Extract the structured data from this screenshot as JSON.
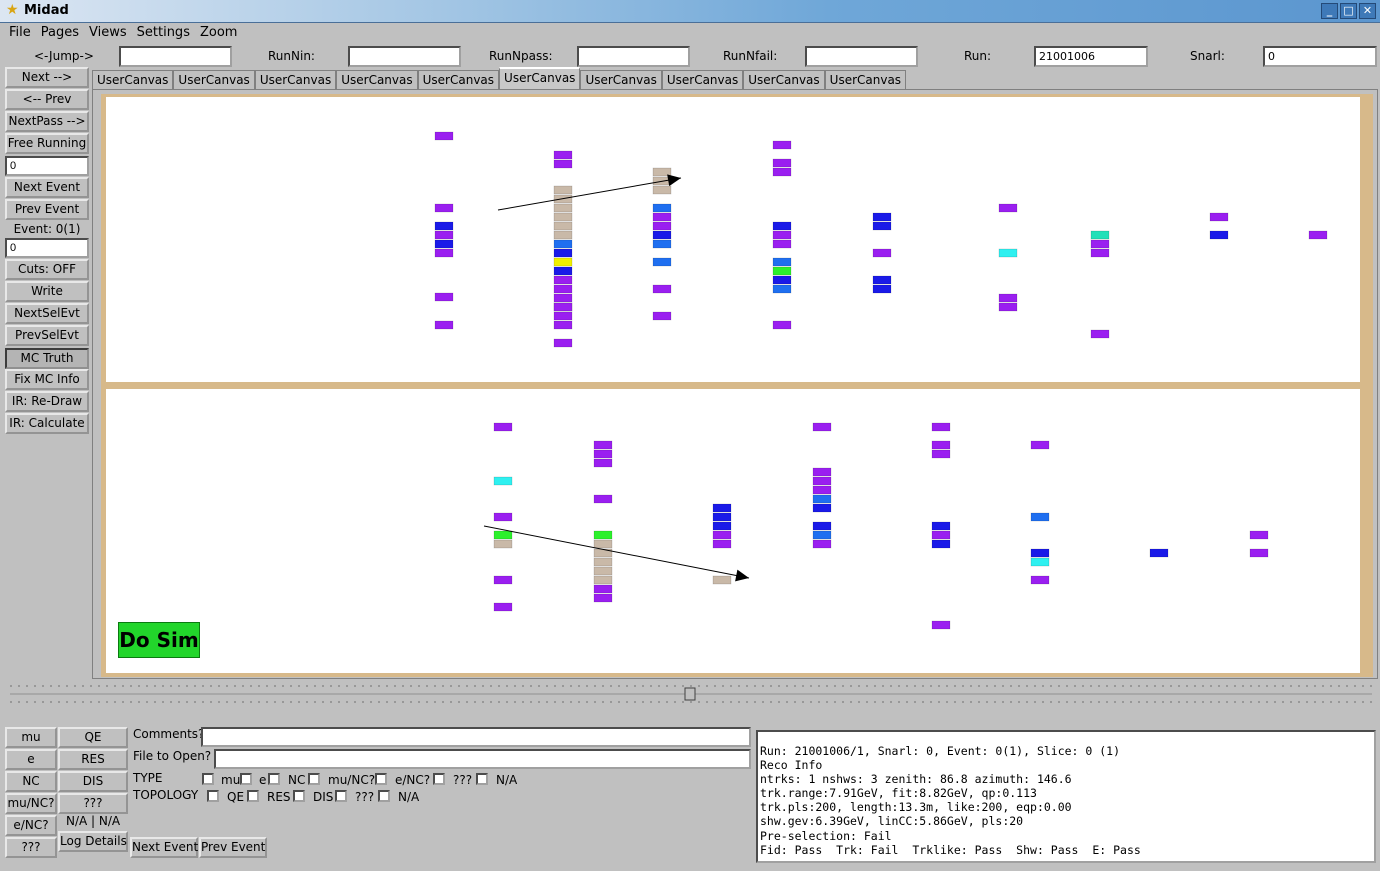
{
  "window": {
    "title": "Midad"
  },
  "menu": [
    "File",
    "Pages",
    "Views",
    "Settings",
    "Zoom"
  ],
  "fields": {
    "jump_label": "<-Jump->",
    "jump_value": "",
    "runnin_label": "RunNin:",
    "runnin_value": "",
    "runnpass_label": "RunNpass:",
    "runnpass_value": "",
    "runnfail_label": "RunNfail:",
    "runnfail_value": "",
    "run_label": "Run:",
    "run_value": "21001006",
    "snarl_label": "Snarl:",
    "snarl_value": "0"
  },
  "left": {
    "next": "Next -->",
    "prev": "<-- Prev",
    "nextpass": "NextPass -->",
    "free_running": "Free Running",
    "input1": "0",
    "next_event": "Next Event",
    "prev_event": "Prev Event",
    "event_label": "Event: 0(1)",
    "input2": "0",
    "cuts": "Cuts: OFF",
    "write": "Write",
    "nextselevt": "NextSelEvt",
    "prevselevt": "PrevSelEvt",
    "mc_truth": "MC Truth",
    "fix_mc": "Fix MC Info",
    "ir_redraw": "IR: Re-Draw",
    "ir_calc": "IR: Calculate"
  },
  "tabs": [
    "UserCanvas",
    "UserCanvas",
    "UserCanvas",
    "UserCanvas",
    "UserCanvas",
    "UserCanvas",
    "UserCanvas",
    "UserCanvas",
    "UserCanvas",
    "UserCanvas"
  ],
  "active_tab": 5,
  "do_sim": "Do Sim",
  "colors": {
    "purple": "#9a1ff0",
    "blue": "#1a1ae8",
    "midblue": "#1f6ff0",
    "cyan": "#2ff0f0",
    "green": "#2cf02c",
    "yellow": "#f0f000",
    "tan": "#c9b9a8",
    "teal": "#22e0b8"
  },
  "event_display": {
    "top_view": [
      [
        "purple"
      ],
      [
        "purple",
        "purple"
      ],
      [
        "tan",
        "tan",
        "tan"
      ],
      [
        "purple"
      ],
      [
        "purple",
        "purple"
      ],
      [
        "purple"
      ],
      [
        "tan",
        "tan",
        "tan",
        "tan",
        "tan",
        "tan",
        "midblue",
        "blue",
        "yellow",
        "blue",
        "purple",
        "purple",
        "purple",
        "purple"
      ],
      [
        "midblue",
        "purple",
        "purple",
        "blue",
        "midblue"
      ],
      [
        "blue",
        "purple",
        "blue",
        "purple"
      ],
      [
        "blue",
        "purple",
        "purple"
      ],
      [
        "purple"
      ],
      [
        "blue",
        "blue"
      ],
      [
        "midblue"
      ],
      [
        "teal",
        "purple",
        "purple"
      ],
      [
        "purple"
      ],
      [
        "blue"
      ],
      [
        "purple"
      ],
      [
        "purple"
      ],
      [
        "purple",
        "purple",
        "purple"
      ],
      [
        "purple"
      ],
      [
        "purple"
      ],
      [
        "midblue",
        "green",
        "blue",
        "midblue"
      ],
      [
        "purple"
      ],
      [
        "purple"
      ],
      [
        "blue",
        "blue"
      ],
      [
        "purple"
      ],
      [
        "cyan"
      ],
      [
        "purple",
        "purple"
      ],
      [
        "purple"
      ],
      [
        "purple"
      ]
    ],
    "bottom_view": [
      [
        "purple"
      ],
      [
        "purple",
        "purple",
        "purple"
      ],
      [
        "purple"
      ],
      [
        "cyan"
      ],
      [
        "purple"
      ],
      [
        "green",
        "tan"
      ],
      [
        "purple"
      ],
      [
        "purple"
      ],
      [
        "green",
        "tan",
        "tan",
        "tan",
        "tan",
        "tan",
        "purple",
        "purple"
      ],
      [
        "blue",
        "blue",
        "blue",
        "purple",
        "purple"
      ],
      [
        "tan"
      ],
      [
        "purple"
      ],
      [
        "purple",
        "purple",
        "purple",
        "midblue",
        "blue"
      ],
      [
        "blue",
        "purple",
        "blue"
      ],
      [
        "purple"
      ],
      [
        "purple",
        "purple"
      ],
      [
        "blue",
        "midblue",
        "purple"
      ],
      [
        "purple"
      ],
      [
        "purple"
      ],
      [
        "midblue"
      ],
      [
        "blue",
        "cyan"
      ],
      [
        "purple"
      ],
      [
        "blue"
      ],
      [
        "purple"
      ],
      [
        "purple"
      ]
    ]
  },
  "bottom": {
    "mu": "mu",
    "qe": "QE",
    "e": "e",
    "res": "RES",
    "nc": "NC",
    "dis": "DIS",
    "munc": "mu/NC?",
    "qqq1": "???",
    "enc": "e/NC?",
    "nana": "N/A | N/A",
    "qqq2": "???",
    "log_details": "Log Details",
    "comments_label": "Comments?",
    "comments_value": "",
    "file_label": "File to Open?",
    "file_value": "",
    "type_label": "TYPE",
    "type_opts": [
      "mu",
      "e",
      "NC",
      "mu/NC?",
      "e/NC?",
      "???",
      "N/A"
    ],
    "topology_label": "TOPOLOGY",
    "topology_opts": [
      "QE",
      "RES",
      "DIS",
      "???",
      "N/A"
    ],
    "next_event": "Next Event",
    "prev_event": "Prev Event"
  },
  "info": {
    "line1": "Run: 21001006/1, Snarl: 0, Event: 0(1), Slice: 0 (1)",
    "line2": "Reco Info",
    "line3": "ntrks: 1 nshws: 3 zenith: 86.8 azimuth: 146.6",
    "line4": "trk.range:7.91GeV, fit:8.82GeV, qp:0.113",
    "line5": "trk.pls:200, length:13.3m, like:200, eqp:0.00",
    "line6": "shw.gev:6.39GeV, linCC:5.86GeV, pls:20",
    "line7": "Pre-selection: Fail",
    "line8": "Fid: Pass  Trk: Fail  Trklike: Pass  Shw: Pass  E: Pass"
  }
}
